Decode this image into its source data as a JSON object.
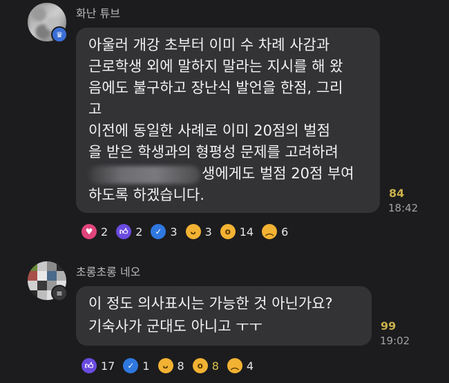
{
  "messages": [
    {
      "sender": "화난 튜브",
      "avatar_badge_icon": "crown-icon",
      "lines": [
        "아울러 개강 초부터 이미 수 차례 사감과",
        "근로학생 외에 말하지 말라는 지시를 해 왔",
        "음에도 불구하고 장난식 발언을 한점, 그리",
        "고",
        " 이전에 동일한 사례로 이미 20점의 벌점",
        "을 받은 학생과의 형평성 문제를 고려하려",
        "생에게도 벌점 20점 부여",
        "하도록 하겠습니다."
      ],
      "unread_count": "84",
      "time": "18:42",
      "reactions": [
        {
          "icon": "heart-icon",
          "count": "2",
          "color": "#e0457b"
        },
        {
          "icon": "thumbs-up-icon",
          "count": "2",
          "color": "#6a4be0"
        },
        {
          "icon": "check-icon",
          "count": "3",
          "color": "#2f78e0"
        },
        {
          "icon": "laughing-face-icon",
          "count": "3",
          "color": "#f2b233"
        },
        {
          "icon": "surprised-face-icon",
          "count": "14",
          "color": "#f2b233"
        },
        {
          "icon": "sad-face-icon",
          "count": "6",
          "color": "#f2b233"
        }
      ]
    },
    {
      "sender": "초롱초롱 네오",
      "avatar_badge_icon": "menu-icon",
      "lines": [
        "이 정도 의사표시는 가능한 것 아닌가요?",
        "기숙사가 군대도 아니고 ㅜㅜ"
      ],
      "unread_count": "99",
      "time": "19:02",
      "reactions": [
        {
          "icon": "thumbs-up-icon",
          "count": "17",
          "color": "#6a4be0"
        },
        {
          "icon": "check-icon",
          "count": "1",
          "color": "#2f78e0"
        },
        {
          "icon": "laughing-face-icon",
          "count": "8",
          "color": "#f2b233"
        },
        {
          "icon": "surprised-face-icon",
          "count": "8",
          "color": "#f2b233",
          "highlight": true
        },
        {
          "icon": "sad-face-icon",
          "count": "4",
          "color": "#f2b233"
        }
      ]
    }
  ]
}
